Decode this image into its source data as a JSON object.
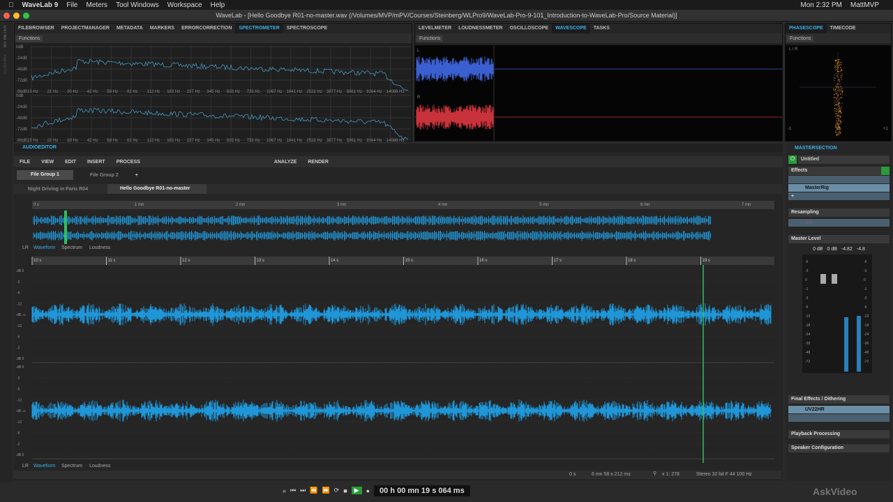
{
  "menubar": {
    "app": "WaveLab 9",
    "items": [
      "File",
      "Meters",
      "Tool Windows",
      "Workspace",
      "Help"
    ],
    "clock": "Mon 2:32 PM",
    "user": "MattMVP"
  },
  "window": {
    "title": "WaveLab - [Hello Goodbye R01-no-master.wav (/Volumes/MVP/mPV/Courses/Steinberg/WLPro9/WaveLab-Pro-9-101_Introduction-to-WaveLab-Pro/Source Material)]"
  },
  "side_strip": {
    "labels": [
      "BIT METER",
      "PLUG-INS"
    ]
  },
  "top_left": {
    "tabs": [
      "Filebrowser",
      "Projectmanager",
      "Metadata",
      "Markers",
      "Errorcorrection",
      "Spectrometer",
      "Spectroscope"
    ],
    "active": "Spectrometer",
    "functions": "Functions",
    "db_labels": [
      "0dB",
      "-24dB",
      "-48dB",
      "-72dB",
      "-96dB"
    ],
    "hz_labels": [
      "15 Hz",
      "21 Hz",
      "30 Hz",
      "42 Hz",
      "58 Hz",
      "81 Hz",
      "112 Hz",
      "163 Hz",
      "237 Hz",
      "345 Hz",
      "503 Hz",
      "733 Hz",
      "1067 Hz",
      "1641 Hz",
      "2522 Hz",
      "3877 Hz",
      "5961 Hz",
      "9164 Hz",
      "14088 Hz"
    ]
  },
  "top_mid": {
    "tabs": [
      "Levelmeter",
      "Loudnessmeter",
      "Oscilloscope",
      "Wavescope",
      "Tasks"
    ],
    "active": "Wavescope",
    "functions": "Functions",
    "ch_l": "L",
    "ch_r": "R",
    "colors": {
      "left": "#3a5fd0",
      "right": "#c8323a"
    }
  },
  "top_right": {
    "tabs": [
      "Phasescope",
      "Timecode"
    ],
    "active": "Phasescope",
    "functions": "Functions",
    "lr": "L / R",
    "scale": [
      "-1",
      "0",
      "+1"
    ]
  },
  "editor": {
    "title": "AudioEditor",
    "menu": [
      "File",
      "View",
      "Edit",
      "Insert",
      "Process"
    ],
    "menu_right": [
      "Analyze",
      "Render"
    ],
    "groups": [
      "File Group 1",
      "File Group 2"
    ],
    "add": "+",
    "files": [
      "Night Driving in Paris R04",
      "Hello Goodbye R01-no-master"
    ],
    "overview_ruler": [
      "0 s",
      "1 mn",
      "2 mn",
      "3 mn",
      "4 mn",
      "5 mn",
      "6 mn",
      "7 mn"
    ],
    "view_tabs": {
      "lr": "LR",
      "items": [
        "Waveform",
        "Spectrum",
        "Loudness"
      ]
    },
    "main_ruler": [
      "10 s",
      "11 s",
      "12 s",
      "13 s",
      "14 s",
      "15 s",
      "16 s",
      "17 s",
      "18 s",
      "19 s"
    ],
    "db_scale": [
      "dB 0",
      "-2",
      "-6",
      "-12",
      "dB -∞",
      "-12",
      "-6",
      "-2",
      "dB 0"
    ],
    "wave_color": "#1e96d8",
    "status": {
      "start": "0 s",
      "length": "6 mn 58 s 212 ms",
      "zoom": "x 1: 278",
      "format": "Stereo 32 bit F 44 100 Hz"
    }
  },
  "transport": {
    "time": "00 h 00 mn 19 s 064 ms"
  },
  "master": {
    "title": "MasterSection",
    "preset": "Untitled",
    "effects": "Effects",
    "rig": "MasterRig",
    "resampling": "Resampling",
    "resampling_value": "Off",
    "master_level": "Master Level",
    "levels": [
      "0 dB",
      "0 dB",
      "-4.82",
      "-4.8"
    ],
    "meter_scale": [
      "-6",
      "-3",
      "0",
      "-1",
      "-3",
      "-6",
      "-12",
      "-18",
      "-24",
      "-36",
      "-48",
      "-72"
    ],
    "final": "Final Effects / Dithering",
    "dither": "UV22HR",
    "playback": "Playback Processing",
    "speaker": "Speaker Configuration"
  },
  "watermark": "AskVideo"
}
